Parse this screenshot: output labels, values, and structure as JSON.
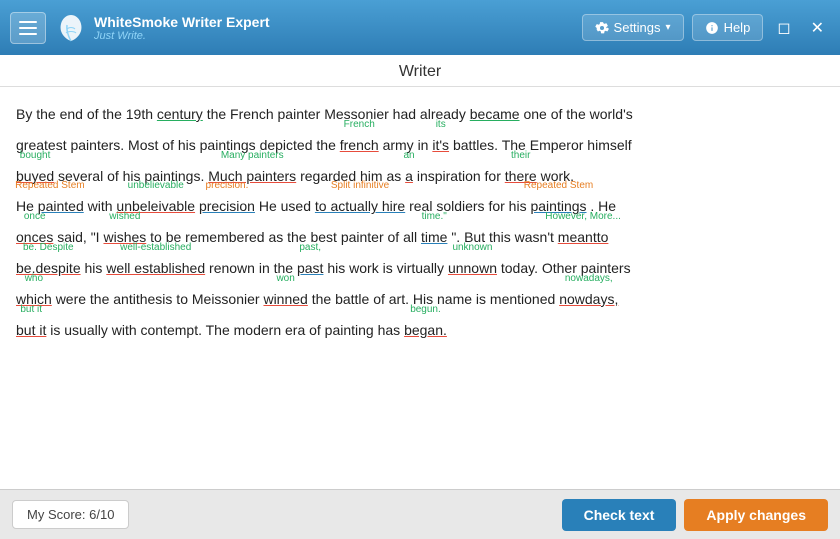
{
  "app": {
    "title": "WhiteSmoke Writer Expert",
    "subtitle": "Just Write.",
    "window_title": "Writer"
  },
  "toolbar": {
    "settings_label": "Settings",
    "help_label": "Help",
    "hamburger_label": "Menu"
  },
  "bottom": {
    "score_label": "My Score: 6/10",
    "check_text_label": "Check text",
    "apply_changes_label": "Apply changes"
  },
  "content": {
    "paragraph": "By the end of the 19th century the French painter Messonier had already became one of the world's greatest painters. Most of his paintings depicted the french army in it's battles. The Emperor himself buyed several of his paintings. Much painters regarded him as a inspiration for there work. He painted with unbeleivable precision He used to actually hire real soldiers for his paintings. He onces said, \"I wishes to be remembered as the best painter of all time\". But this wasn't meantto be.despite his well established renown in the past his work is virtually unnown today. Other painters which were the antithesis to Meissonier winned the battle of art. His name is mentioned nowdays, but it is usually with contempt. The modern era of painting has began."
  }
}
